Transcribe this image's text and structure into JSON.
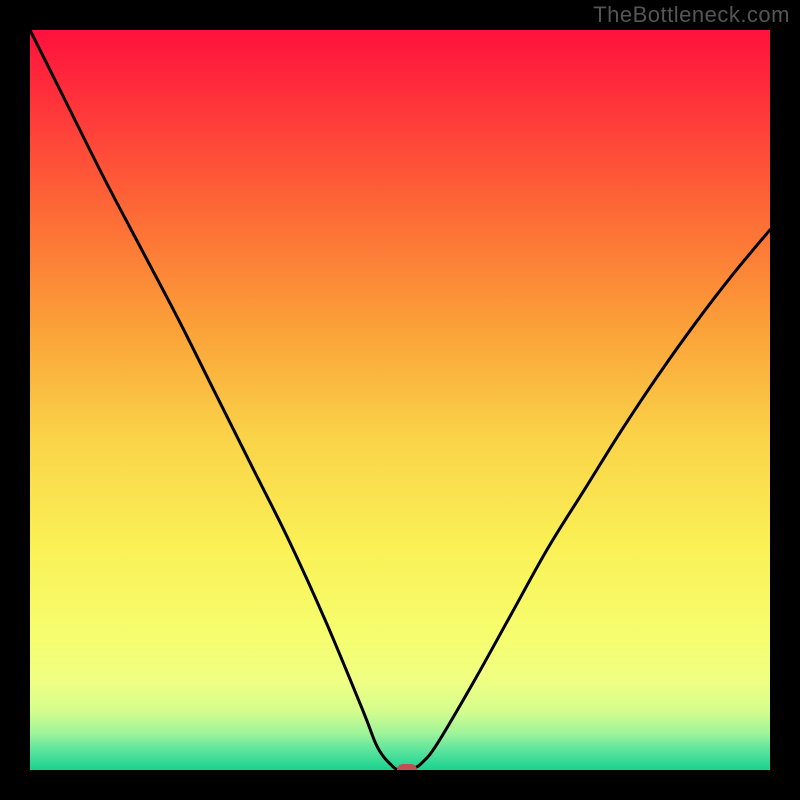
{
  "watermark": "TheBottleneck.com",
  "chart_data": {
    "type": "line",
    "title": "",
    "xlabel": "",
    "ylabel": "",
    "xlim": [
      0,
      100
    ],
    "ylim": [
      0,
      100
    ],
    "grid": false,
    "legend": false,
    "series": [
      {
        "name": "bottleneck-curve",
        "color": "#000000",
        "x": [
          0,
          5,
          10,
          15,
          20,
          25,
          30,
          35,
          40,
          45,
          47,
          49,
          50,
          51,
          52,
          53,
          55,
          60,
          65,
          70,
          75,
          80,
          85,
          90,
          95,
          100
        ],
        "y": [
          100,
          90,
          80,
          70.5,
          61,
          51,
          41,
          31,
          20,
          8,
          3,
          0.5,
          0,
          0,
          0.3,
          1,
          3.5,
          12,
          21,
          30,
          38,
          46,
          53.5,
          60.5,
          67,
          73
        ]
      }
    ],
    "marker": {
      "x": 51,
      "y": 0,
      "color": "#c05054"
    },
    "background_gradient": {
      "stops": [
        {
          "offset": 0.0,
          "color": "#ff113d"
        },
        {
          "offset": 0.12,
          "color": "#ff3b3a"
        },
        {
          "offset": 0.25,
          "color": "#fd6b36"
        },
        {
          "offset": 0.4,
          "color": "#fba038"
        },
        {
          "offset": 0.55,
          "color": "#fad348"
        },
        {
          "offset": 0.7,
          "color": "#faf156"
        },
        {
          "offset": 0.82,
          "color": "#f6fe6f"
        },
        {
          "offset": 0.88,
          "color": "#f0ff83"
        },
        {
          "offset": 0.92,
          "color": "#d5fd8d"
        },
        {
          "offset": 0.95,
          "color": "#a0f49a"
        },
        {
          "offset": 0.975,
          "color": "#57e39d"
        },
        {
          "offset": 1.0,
          "color": "#19d28f"
        }
      ]
    }
  }
}
